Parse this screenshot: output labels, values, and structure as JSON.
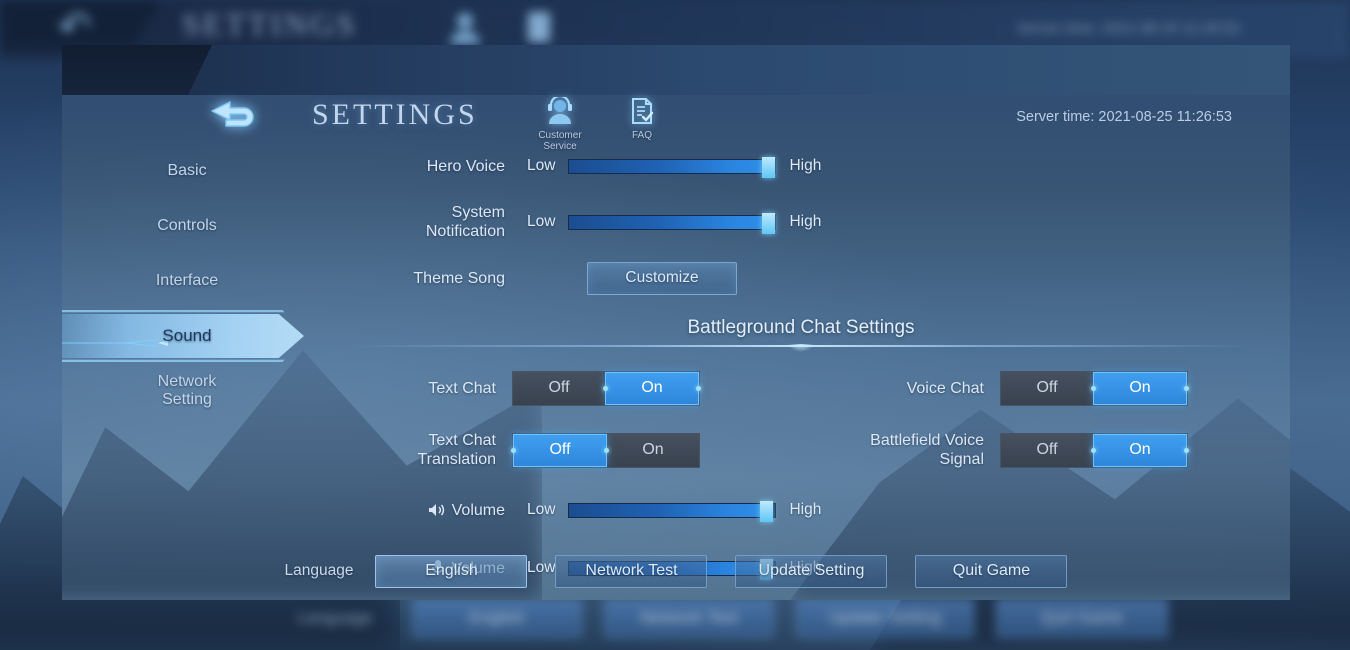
{
  "header": {
    "back_icon": "back-arrow-icon",
    "title": "SETTINGS",
    "icons": [
      {
        "name": "customer-service-icon",
        "caption_line1": "Customer",
        "caption_line2": "Service"
      },
      {
        "name": "faq-icon",
        "caption_line1": "FAQ",
        "caption_line2": ""
      }
    ],
    "server_time": "Server time: 2021-08-25 11:26:53"
  },
  "sidebar": {
    "items": [
      {
        "label": "Basic",
        "active": false
      },
      {
        "label": "Controls",
        "active": false
      },
      {
        "label": "Interface",
        "active": false
      },
      {
        "label": "Sound",
        "active": true
      },
      {
        "label": "Network",
        "label2": "Setting",
        "active": false
      }
    ]
  },
  "main": {
    "sliders_top": [
      {
        "label": "Hero Voice",
        "low": "Low",
        "high": "High",
        "value": 97
      },
      {
        "label": "System",
        "label2": "Notification",
        "low": "Low",
        "high": "High",
        "value": 97
      }
    ],
    "theme_song": {
      "label": "Theme Song",
      "button": "Customize"
    },
    "section_title": "Battleground Chat Settings",
    "toggles": [
      {
        "label": "Text Chat",
        "off": "Off",
        "on": "On",
        "value": "On"
      },
      {
        "label": "Voice Chat",
        "off": "Off",
        "on": "On",
        "value": "On"
      },
      {
        "label": "Text Chat",
        "label2": "Translation",
        "off": "Off",
        "on": "On",
        "value": "Off"
      },
      {
        "label": "Battlefield Voice",
        "label2": "Signal",
        "off": "Off",
        "on": "On",
        "value": "On"
      }
    ],
    "volume_sliders": [
      {
        "icon": "speaker-icon",
        "label": "Volume",
        "low": "Low",
        "high": "High",
        "value": 96
      },
      {
        "icon": "microphone-icon",
        "label": "Volume",
        "low": "Low",
        "high": "High",
        "value": 96
      }
    ]
  },
  "bottom_bar": {
    "language_label": "Language",
    "buttons": [
      {
        "label": "English",
        "primary": true
      },
      {
        "label": "Network Test",
        "primary": false
      },
      {
        "label": "Update Setting",
        "primary": false
      },
      {
        "label": "Quit Game",
        "primary": false
      }
    ]
  },
  "colors": {
    "accent_blue": "#2f86db",
    "knob_cyan": "#5fc6f5",
    "panel_top": "#2e4a72",
    "header_dark": "#16243c"
  }
}
